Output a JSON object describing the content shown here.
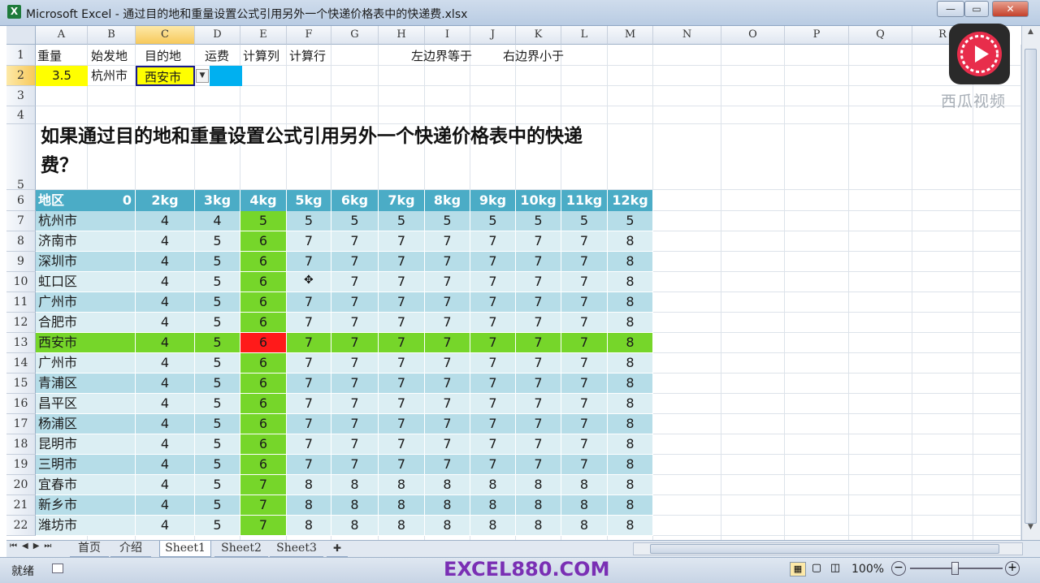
{
  "window": {
    "title": "Microsoft Excel - 通过目的地和重量设置公式引用另外一个快递价格表中的快递费.xlsx",
    "app_icon": "X",
    "minimize": "—",
    "restore": "▭",
    "close": "✕"
  },
  "columns": [
    "A",
    "B",
    "C",
    "D",
    "E",
    "F",
    "G",
    "H",
    "I",
    "J",
    "K",
    "L",
    "M",
    "N",
    "O",
    "P",
    "Q",
    "R"
  ],
  "row_numbers": [
    "1",
    "2",
    "3",
    "4",
    "5",
    "6",
    "7",
    "8",
    "9",
    "10",
    "11",
    "12",
    "13",
    "14",
    "15",
    "16",
    "17",
    "18",
    "19",
    "20",
    "21",
    "22"
  ],
  "row1": {
    "a": "重量",
    "b": "始发地",
    "c": "目的地",
    "d": "运费",
    "e": "计算列",
    "f": "计算行",
    "i": "左边界等于",
    "k": "右边界小于"
  },
  "row2": {
    "a": "3.5",
    "b": "杭州市",
    "c": "西安市"
  },
  "heading_line1": "如果通过目的地和重量设置公式引用另外一个快递价格表中的快递",
  "heading_line2": "费？",
  "table": {
    "header_region": "地区",
    "header_zero": "0",
    "weights": [
      "2kg",
      "3kg",
      "4kg",
      "5kg",
      "6kg",
      "7kg",
      "8kg",
      "9kg",
      "10kg",
      "11kg",
      "12kg"
    ],
    "rows": [
      {
        "region": "杭州市",
        "values": [
          "4",
          "4",
          "5",
          "5",
          "5",
          "5",
          "5",
          "5",
          "5",
          "5",
          "5"
        ]
      },
      {
        "region": "济南市",
        "values": [
          "4",
          "5",
          "6",
          "7",
          "7",
          "7",
          "7",
          "7",
          "7",
          "7",
          "8"
        ]
      },
      {
        "region": "深圳市",
        "values": [
          "4",
          "5",
          "6",
          "7",
          "7",
          "7",
          "7",
          "7",
          "7",
          "7",
          "8"
        ]
      },
      {
        "region": "虹口区",
        "values": [
          "4",
          "5",
          "6",
          "",
          "7",
          "7",
          "7",
          "7",
          "7",
          "7",
          "8"
        ]
      },
      {
        "region": "广州市",
        "values": [
          "4",
          "5",
          "6",
          "7",
          "7",
          "7",
          "7",
          "7",
          "7",
          "7",
          "8"
        ]
      },
      {
        "region": "合肥市",
        "values": [
          "4",
          "5",
          "6",
          "7",
          "7",
          "7",
          "7",
          "7",
          "7",
          "7",
          "8"
        ]
      },
      {
        "region": "西安市",
        "values": [
          "4",
          "5",
          "6",
          "7",
          "7",
          "7",
          "7",
          "7",
          "7",
          "7",
          "8"
        ]
      },
      {
        "region": "广州市",
        "values": [
          "4",
          "5",
          "6",
          "7",
          "7",
          "7",
          "7",
          "7",
          "7",
          "7",
          "8"
        ]
      },
      {
        "region": "青浦区",
        "values": [
          "4",
          "5",
          "6",
          "7",
          "7",
          "7",
          "7",
          "7",
          "7",
          "7",
          "8"
        ]
      },
      {
        "region": "昌平区",
        "values": [
          "4",
          "5",
          "6",
          "7",
          "7",
          "7",
          "7",
          "7",
          "7",
          "7",
          "8"
        ]
      },
      {
        "region": "杨浦区",
        "values": [
          "4",
          "5",
          "6",
          "7",
          "7",
          "7",
          "7",
          "7",
          "7",
          "7",
          "8"
        ]
      },
      {
        "region": "昆明市",
        "values": [
          "4",
          "5",
          "6",
          "7",
          "7",
          "7",
          "7",
          "7",
          "7",
          "7",
          "8"
        ]
      },
      {
        "region": "三明市",
        "values": [
          "4",
          "5",
          "6",
          "7",
          "7",
          "7",
          "7",
          "7",
          "7",
          "7",
          "8"
        ]
      },
      {
        "region": "宜春市",
        "values": [
          "4",
          "5",
          "7",
          "8",
          "8",
          "8",
          "8",
          "8",
          "8",
          "8",
          "8"
        ]
      },
      {
        "region": "新乡市",
        "values": [
          "4",
          "5",
          "7",
          "8",
          "8",
          "8",
          "8",
          "8",
          "8",
          "8",
          "8"
        ]
      },
      {
        "region": "潍坊市",
        "values": [
          "4",
          "5",
          "7",
          "8",
          "8",
          "8",
          "8",
          "8",
          "8",
          "8",
          "8"
        ]
      }
    ]
  },
  "sheet_tabs": [
    "首页",
    "介绍",
    "Sheet1",
    "Sheet2",
    "Sheet3"
  ],
  "active_sheet": "Sheet1",
  "status": {
    "ready": "就绪",
    "watermark": "EXCEL880.COM",
    "zoom": "100%"
  },
  "logo_text": "西瓜视频",
  "colors": {
    "header_teal": "#4bacc6",
    "highlight_green": "#76d62a",
    "highlight_red": "#ff1a1a",
    "row_light": "#dbeef3",
    "row_dark": "#b6dde8",
    "yellow": "#ffff00",
    "cyan": "#00b0f0"
  }
}
